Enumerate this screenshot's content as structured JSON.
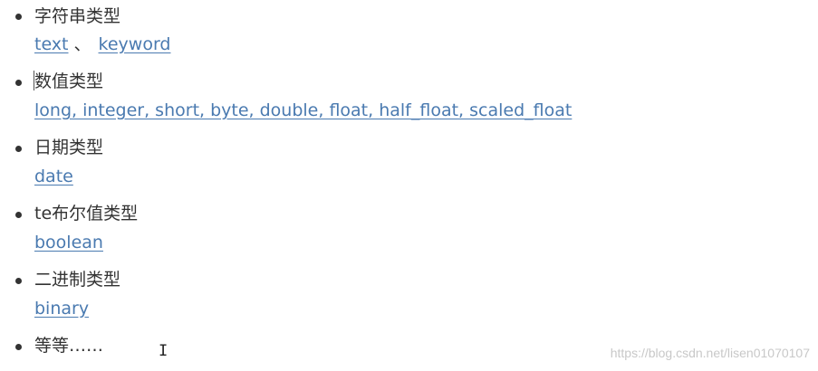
{
  "items": [
    {
      "heading": "字符串类型",
      "links": [
        "text",
        "keyword"
      ],
      "separator": "、"
    },
    {
      "heading": "数值类型",
      "links": [
        "long, integer, short, byte, double, float, half_float, scaled_float"
      ]
    },
    {
      "heading": "日期类型",
      "links": [
        "date"
      ]
    },
    {
      "heading": "te布尔值类型",
      "links": [
        "boolean"
      ]
    },
    {
      "heading": "二进制类型",
      "links": [
        "binary"
      ]
    },
    {
      "heading": "等等……"
    }
  ],
  "cursor_glyph": "I",
  "watermark": "https://blog.csdn.net/lisen01070107",
  "colors": {
    "text": "#333333",
    "link": "#4a7ab0",
    "watermark": "#c8c8c8"
  }
}
